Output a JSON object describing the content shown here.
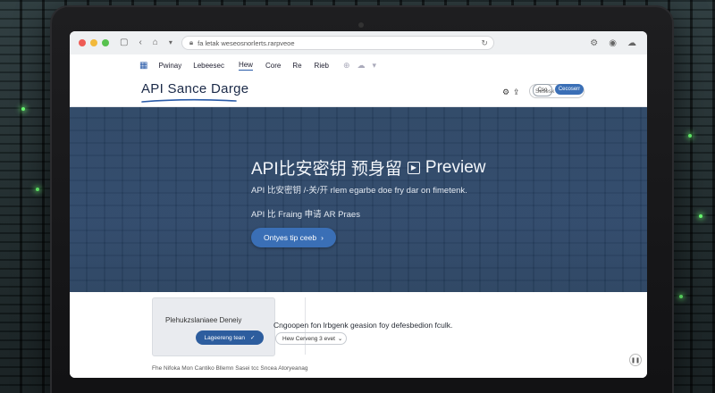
{
  "browser": {
    "url": "fa letak weseosnorlerts.rarpveoe",
    "reload_icon": "reload-icon"
  },
  "nav": {
    "items": [
      "Pwinay",
      "Lebeesec",
      "Hew",
      "Core",
      "Re",
      "Rieb"
    ]
  },
  "brand": {
    "name": "API Sance Darge"
  },
  "header": {
    "search_placeholder": "Sesesk",
    "outline_label": "Cso",
    "primary_label": "Cecoserr"
  },
  "hero": {
    "title": "API比安密钥 预身留",
    "title_suffix": "Preview",
    "subtitle1": "API 比安密钥 /-关/开 rlem egarbe doe fry dar on fimetenk.",
    "subtitle2": "API 比 Fraing 申请 AR Praes",
    "cta_label": "Ontyes tip ceeb",
    "cta_arrow": "›"
  },
  "preview_card": {
    "title": "Plehukzslaniaee Deneiy",
    "button_label": "Lageereng tean",
    "button_check": "✓"
  },
  "content": {
    "description": "Cngoopen fon lrbgenk geasion foy defesbedion fculk.",
    "select_label": "Hew Cerveng 3 evet",
    "select_chevron": "⌄",
    "footer": "Fhe Nifoka Mon Cantiko Bllemn Sasei tcc Sncea Atoryeanag"
  },
  "colors": {
    "accent": "#3a6fb6",
    "hero_bg": "#2c4668",
    "brand_text": "#1b2a48"
  }
}
